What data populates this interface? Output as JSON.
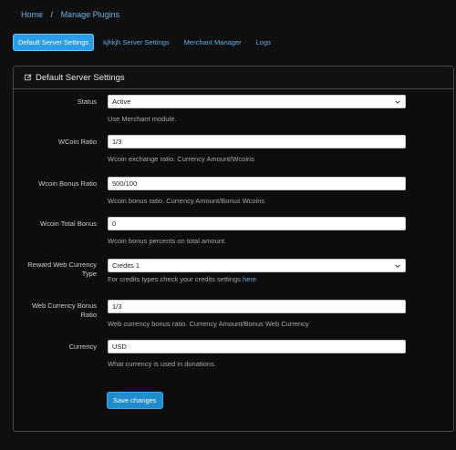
{
  "breadcrumb": {
    "home": "Home",
    "separator": "/",
    "current": "Manage Plugins"
  },
  "tabs": [
    {
      "label": "Default Server Settings",
      "active": true
    },
    {
      "label": "kjhkjh Server Settings",
      "active": false
    },
    {
      "label": "Merchant Manager",
      "active": false
    },
    {
      "label": "Logs",
      "active": false
    }
  ],
  "card": {
    "title": "Default Server Settings",
    "fields": {
      "status": {
        "label": "Status",
        "value": "Active",
        "help": "Use Merchant module."
      },
      "wcoin_ratio": {
        "label": "WCoin Ratio",
        "value": "1/3",
        "help": "Wcoin exchange ratio. Currency Amount/Wcoins"
      },
      "wcoin_bonus_ratio": {
        "label": "Wcoin Bonus Ratio",
        "value": "500/100",
        "help": "Wcoin bonus ratio. Currency Amount/Bonus Wcoins"
      },
      "wcoin_total_bonus": {
        "label": "Wcoin Total Bonus",
        "value": "0",
        "help": "Wcoin bonus percents on total amount."
      },
      "reward_web_currency_type": {
        "label_line1": "Reward Web Currency",
        "label_line2": "Type",
        "value": "Credits 1",
        "help": "For credits types check your credits settings",
        "help_link": "here"
      },
      "web_currency_bonus_ratio": {
        "label_line1": "Web Currency Bonus",
        "label_line2": "Ratio",
        "value": "1/3",
        "help": "Web currency bonus ratio. Currency Amount/Bonus Web Currency"
      },
      "currency": {
        "label": "Currency",
        "value": "USD",
        "help": "What currency is used in donations."
      }
    },
    "save_label": "Save changes"
  },
  "colors": {
    "accent": "#2b9de6",
    "link": "#63adee",
    "background": "#0f0f0f"
  }
}
